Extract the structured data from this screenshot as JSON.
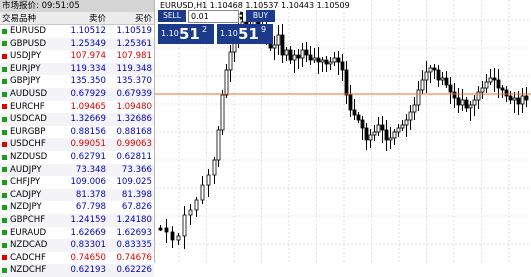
{
  "market_watch": {
    "title": "市场报价: 09:51:05",
    "columns": {
      "symbol": "交易品种",
      "bid": "卖价",
      "ask": "买价"
    },
    "rows": [
      {
        "symbol": "EURUSD",
        "bid": "1.10512",
        "ask": "1.10519",
        "dir": "up"
      },
      {
        "symbol": "GBPUSD",
        "bid": "1.25349",
        "ask": "1.25361",
        "dir": "up"
      },
      {
        "symbol": "USDJPY",
        "bid": "107.974",
        "ask": "107.981",
        "dir": "down"
      },
      {
        "symbol": "EURJPY",
        "bid": "119.334",
        "ask": "119.348",
        "dir": "up"
      },
      {
        "symbol": "GBPJPY",
        "bid": "135.350",
        "ask": "135.370",
        "dir": "up"
      },
      {
        "symbol": "AUDUSD",
        "bid": "0.67929",
        "ask": "0.67939",
        "dir": "up"
      },
      {
        "symbol": "EURCHF",
        "bid": "1.09465",
        "ask": "1.09480",
        "dir": "down"
      },
      {
        "symbol": "USDCAD",
        "bid": "1.32669",
        "ask": "1.32686",
        "dir": "up"
      },
      {
        "symbol": "EURGBP",
        "bid": "0.88156",
        "ask": "0.88168",
        "dir": "up"
      },
      {
        "symbol": "USDCHF",
        "bid": "0.99051",
        "ask": "0.99063",
        "dir": "down"
      },
      {
        "symbol": "NZDUSD",
        "bid": "0.62791",
        "ask": "0.62811",
        "dir": "up"
      },
      {
        "symbol": "AUDJPY",
        "bid": "73.348",
        "ask": "73.366",
        "dir": "up"
      },
      {
        "symbol": "CHFJPY",
        "bid": "109.006",
        "ask": "109.025",
        "dir": "up"
      },
      {
        "symbol": "CADJPY",
        "bid": "81.378",
        "ask": "81.398",
        "dir": "up"
      },
      {
        "symbol": "NZDJPY",
        "bid": "67.798",
        "ask": "67.826",
        "dir": "up"
      },
      {
        "symbol": "GBPCHF",
        "bid": "1.24159",
        "ask": "1.24180",
        "dir": "up"
      },
      {
        "symbol": "EURAUD",
        "bid": "1.62669",
        "ask": "1.62693",
        "dir": "up"
      },
      {
        "symbol": "NZDCAD",
        "bid": "0.83301",
        "ask": "0.83335",
        "dir": "up"
      },
      {
        "symbol": "CADCHF",
        "bid": "0.74650",
        "ask": "0.74676",
        "dir": "down"
      },
      {
        "symbol": "NZDCHF",
        "bid": "0.62193",
        "ask": "0.62226",
        "dir": "up"
      }
    ]
  },
  "chart": {
    "title": "EURUSD,H1  1.10468 1.10537 1.10443 1.10509",
    "bid_line_color": "#e8702a",
    "bull_color": "#ffffff",
    "bear_color": "#000000"
  },
  "trade_panel": {
    "sell_label": "SELL",
    "buy_label": "BUY",
    "lot_value": "0.01",
    "sell_price": {
      "prefix": "1.10",
      "big": "51",
      "sup": "2"
    },
    "buy_price": {
      "prefix": "1.10",
      "big": "51",
      "sup": "9"
    }
  },
  "colors": {
    "up_icon": "#1a9e1a",
    "down_icon": "#e00000",
    "panel_blue": "#1c3a8c"
  }
}
